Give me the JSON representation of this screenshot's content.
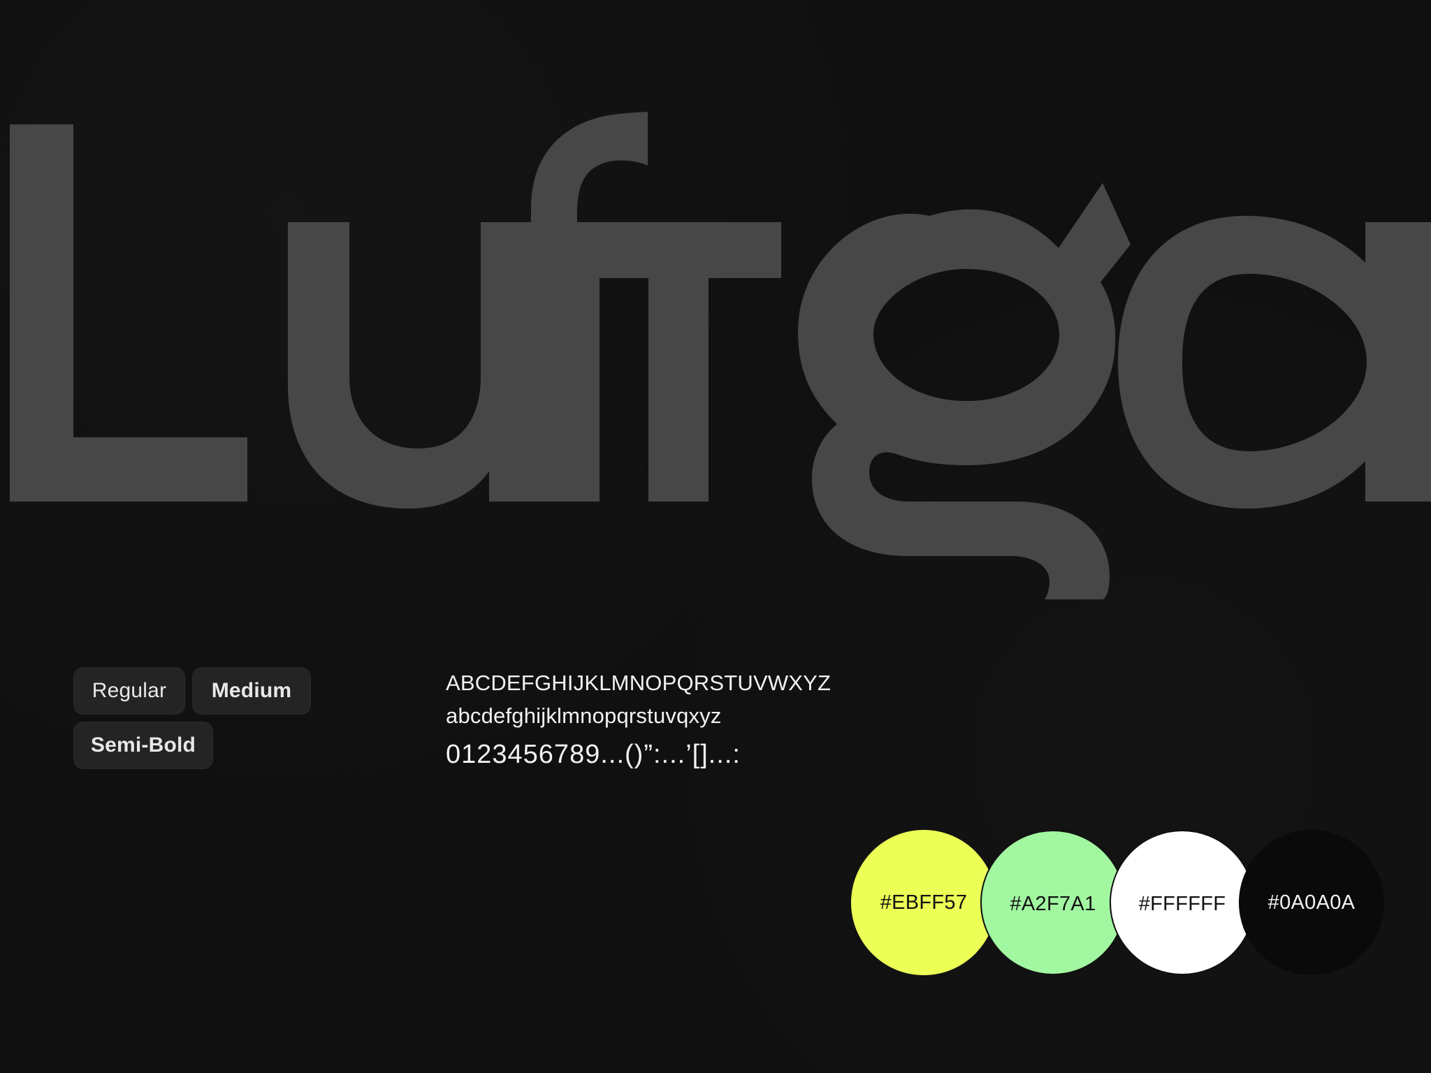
{
  "hero": {
    "word": "Lufga",
    "color": "#474747"
  },
  "weights": {
    "regular": "Regular",
    "medium": "Medium",
    "semibold": "Semi-Bold"
  },
  "glyphs": {
    "uppercase": "ABCDEFGHIJKLMNOPQRSTUVWXYZ",
    "lowercase": "abcdefghijklmnopqrstuvqxyz",
    "numbers": "0123456789...()”:...’[]...:"
  },
  "palette": [
    {
      "label": "#EBFF57",
      "color": "#EBFF57"
    },
    {
      "label": "#A2F7A1",
      "color": "#A2F7A1"
    },
    {
      "label": "#FFFFFF",
      "color": "#FFFFFF"
    },
    {
      "label": "#0A0A0A",
      "color": "#0A0A0A"
    }
  ]
}
